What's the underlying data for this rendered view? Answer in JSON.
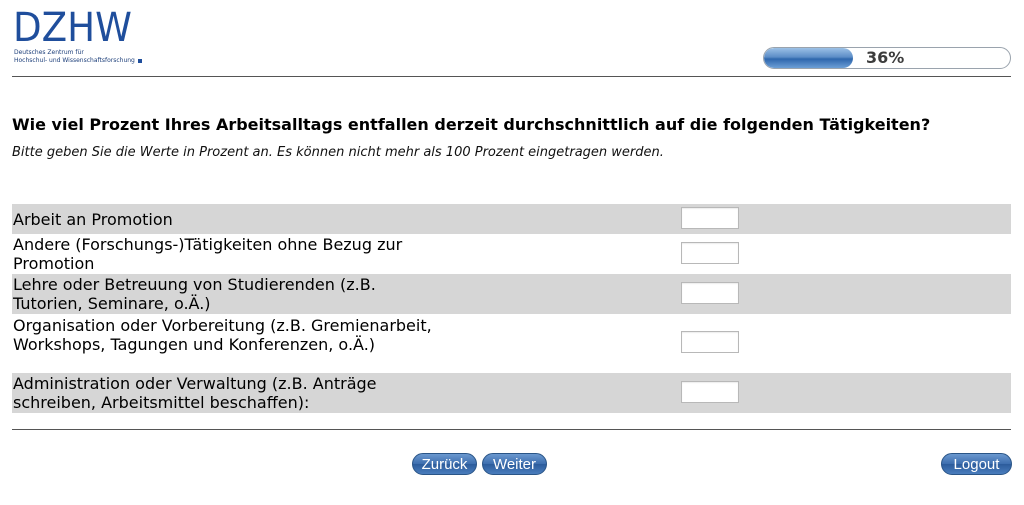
{
  "header": {
    "logo_text": "DZHW",
    "logo_subtitle_line1": "Deutsches Zentrum für",
    "logo_subtitle_line2": "Hochschul- und Wissenschaftsforschung",
    "brand_color": "#1f4e9c",
    "progress": {
      "value": 0.36,
      "label": "36%"
    }
  },
  "question": {
    "title": "Wie viel Prozent Ihres Arbeitsalltags entfallen derzeit durchschnittlich auf die folgenden Tätigkeiten?",
    "instruction": "Bitte geben Sie die Werte in Prozent an. Es können nicht mehr als 100 Prozent eingetragen werden."
  },
  "items": [
    {
      "label": "Arbeit an Promotion",
      "value": ""
    },
    {
      "label": "Andere (Forschungs-)Tätigkeiten ohne Bezug zur Promotion",
      "value": ""
    },
    {
      "label": "Lehre oder Betreuung von Studierenden (z.B. Tutorien, Seminare, o.Ä.)",
      "value": ""
    },
    {
      "label": "Organisation oder Vorbereitung (z.B. Gremienarbeit, Workshops, Tagungen und Konferenzen, o.Ä.)",
      "value": ""
    },
    {
      "label": "Administration oder Verwaltung (z.B. Anträge schreiben, Arbeitsmittel beschaffen):",
      "value": ""
    }
  ],
  "navigation": {
    "back_label": "Zurück",
    "next_label": "Weiter",
    "logout_label": "Logout",
    "button_color": "#3d6eae"
  }
}
